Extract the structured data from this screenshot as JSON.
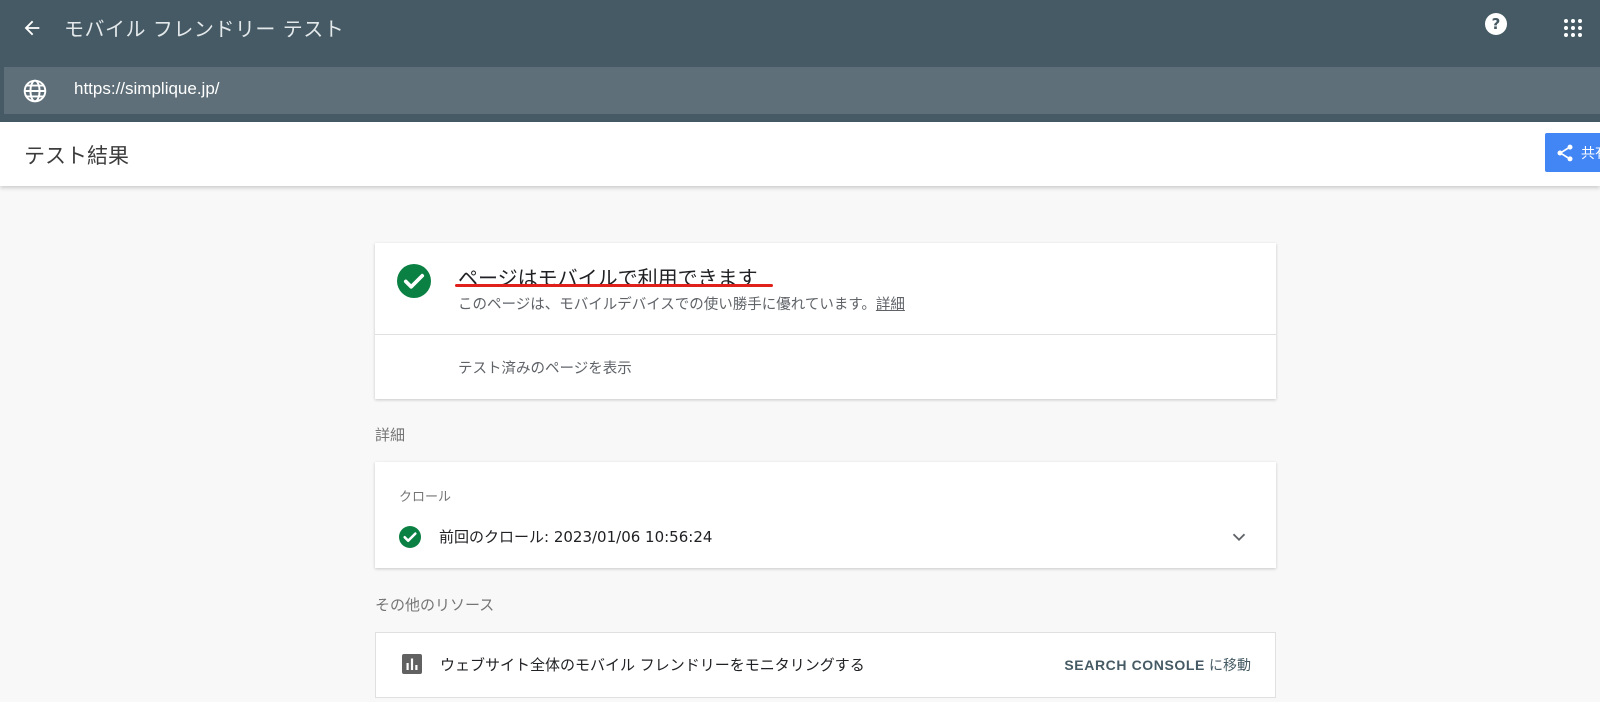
{
  "header": {
    "app_title": "モバイル フレンドリー テスト",
    "help_label": "?",
    "url": "https://simplique.jp/"
  },
  "result_header": {
    "title": "テスト結果",
    "share_label": "共有"
  },
  "summary": {
    "status_title": "ページはモバイルで利用できます",
    "description": "このページは、モバイルデバイスでの使い勝手に優れています。",
    "detail_link": "詳細",
    "view_tested_page": "テスト済みのページを表示"
  },
  "details_section": {
    "label": "詳細",
    "crawl_label": "クロール",
    "last_crawl": "前回のクロール: 2023/01/06 10:56:24"
  },
  "resources_section": {
    "label": "その他のリソース",
    "monitor_text": "ウェブサイト全体のモバイル フレンドリーをモニタリングする",
    "console_label": "SEARCH CONSOLE",
    "console_suffix": "に移動"
  },
  "colors": {
    "topbar": "#455a64",
    "urlbar": "#5e6f79",
    "success": "#0b8043",
    "share_button": "#4285f4",
    "annotation_underline": "#e0201b"
  },
  "icons": [
    "back-arrow-icon",
    "help-icon",
    "apps-grid-icon",
    "globe-icon",
    "share-icon",
    "check-circle-icon",
    "chevron-down-icon",
    "bar-chart-icon"
  ]
}
